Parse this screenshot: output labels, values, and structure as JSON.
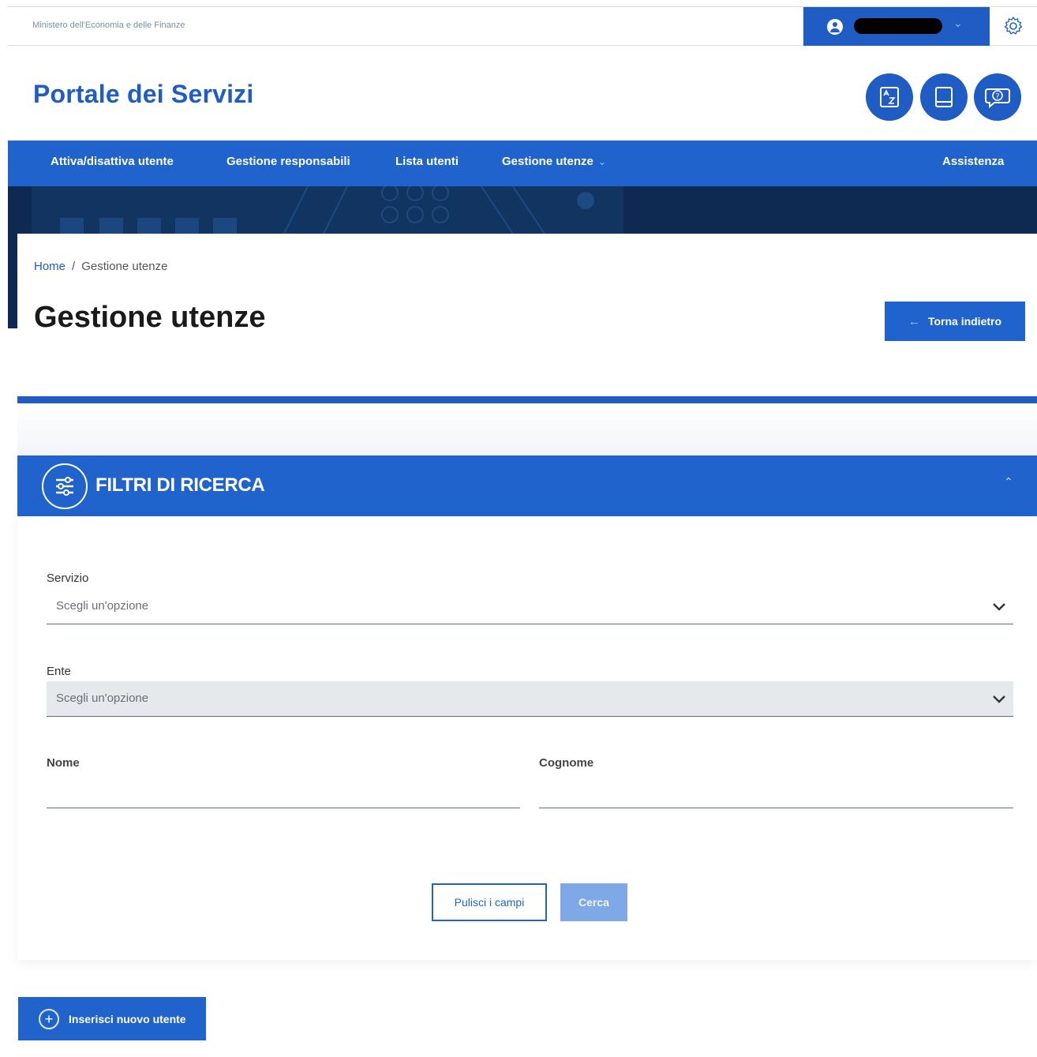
{
  "topbar": {
    "ministry": "Ministero dell'Economia e delle Finanze"
  },
  "header": {
    "brand": "Portale dei Servizi"
  },
  "nav": {
    "items": [
      "Attiva/disattiva utente",
      "Gestione responsabili",
      "Lista utenti",
      "Gestione utenze"
    ],
    "assistance": "Assistenza"
  },
  "breadcrumb": {
    "home": "Home",
    "separator": "/",
    "current": "Gestione utenze"
  },
  "page": {
    "title": "Gestione utenze",
    "back_label": "Torna indietro"
  },
  "filters": {
    "title": "FILTRI DI RICERCA",
    "servizio_label": "Servizio",
    "servizio_value": "Scegli un'opzione",
    "ente_label": "Ente",
    "ente_value": "Scegli un'opzione",
    "nome_label": "Nome",
    "cognome_label": "Cognome",
    "clear_label": "Pulisci i campi",
    "search_label": "Cerca"
  },
  "actions": {
    "new_user_label": "Inserisci nuovo utente"
  },
  "colors": {
    "primary": "#2163cc",
    "dark": "#0e2a52",
    "search_disabled": "#7fa9e6"
  }
}
